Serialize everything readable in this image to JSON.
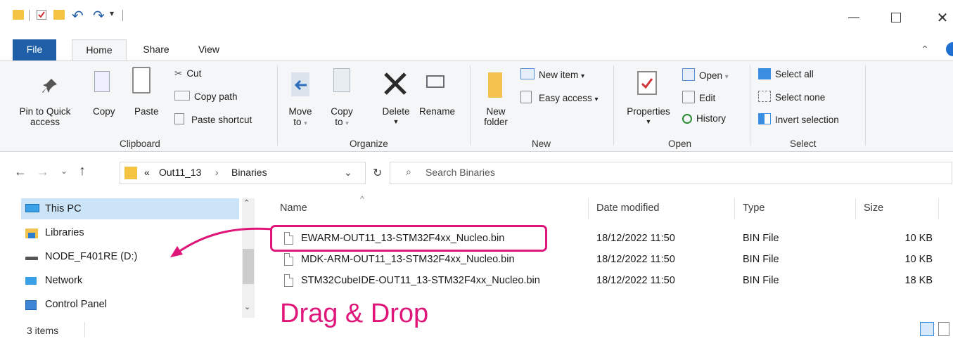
{
  "ribbon_tabs": [
    "File",
    "Home",
    "Share",
    "View"
  ],
  "clipboard": {
    "pin_label": [
      "Pin to Quick",
      "access"
    ],
    "copy": "Copy",
    "paste": "Paste",
    "cut": "Cut",
    "copy_path": "Copy path",
    "paste_shortcut": "Paste shortcut",
    "group": "Clipboard"
  },
  "organize": {
    "move_to": [
      "Move",
      "to"
    ],
    "copy_to": [
      "Copy",
      "to"
    ],
    "delete": "Delete",
    "rename": "Rename",
    "group": "Organize"
  },
  "new": {
    "new_folder": [
      "New",
      "folder"
    ],
    "new_item": "New item",
    "easy_access": "Easy access",
    "group": "New"
  },
  "open": {
    "properties": "Properties",
    "open": "Open",
    "edit": "Edit",
    "history": "History",
    "group": "Open"
  },
  "select": {
    "select_all": "Select all",
    "select_none": "Select none",
    "invert": "Invert selection",
    "group": "Select"
  },
  "address": {
    "crumb_prefix": "«",
    "crumb1": "Out11_13",
    "crumb_sep": "›",
    "crumb2": "Binaries",
    "search_placeholder": "Search Binaries"
  },
  "nav": {
    "items": [
      "This PC",
      "Libraries",
      "NODE_F401RE (D:)",
      "Network",
      "Control Panel"
    ]
  },
  "columns": {
    "name": "Name",
    "date": "Date modified",
    "type": "Type",
    "size": "Size"
  },
  "files": [
    {
      "name": "EWARM-OUT11_13-STM32F4xx_Nucleo.bin",
      "date": "18/12/2022 11:50",
      "type": "BIN File",
      "size": "10 KB"
    },
    {
      "name": "MDK-ARM-OUT11_13-STM32F4xx_Nucleo.bin",
      "date": "18/12/2022 11:50",
      "type": "BIN File",
      "size": "10 KB"
    },
    {
      "name": "STM32CubeIDE-OUT11_13-STM32F4xx_Nucleo.bin",
      "date": "18/12/2022 11:50",
      "type": "BIN File",
      "size": "18 KB"
    }
  ],
  "status": {
    "items": "3 items"
  },
  "annotation": {
    "text": "Drag & Drop",
    "color": "#e0157a"
  }
}
